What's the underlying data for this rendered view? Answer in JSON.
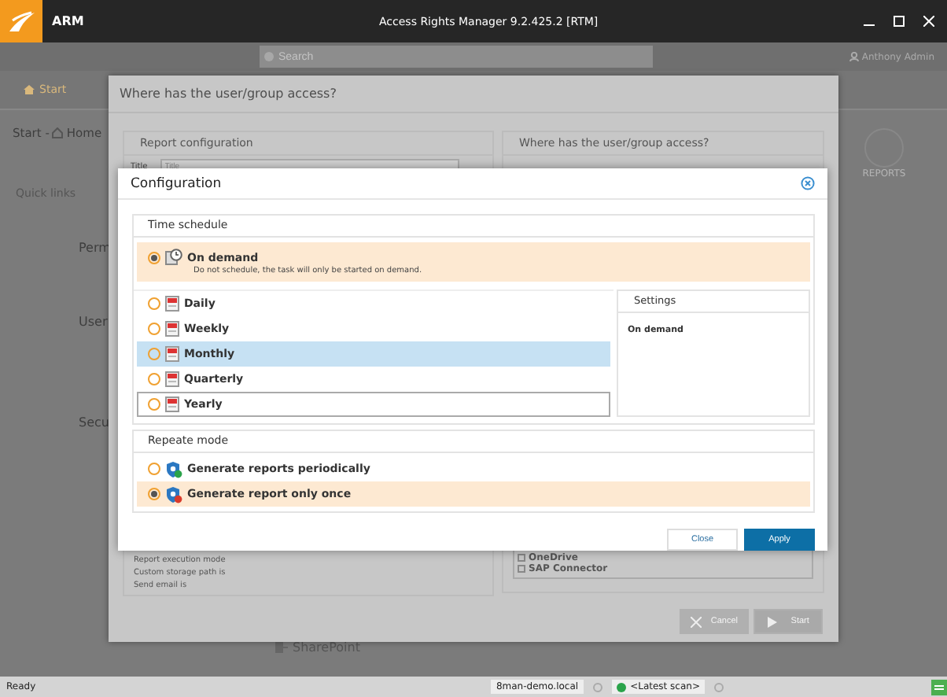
{
  "window": {
    "title": "ARM",
    "app_title": "Access Rights Manager  9.2.425.2 [RTM]"
  },
  "toolbar": {
    "search": {
      "placeholder": "Search"
    },
    "user": "Anthony Admin"
  },
  "nav": [
    "Start"
  ],
  "breadcrumb": {
    "root": "Start -",
    "page": "Home"
  },
  "background": {
    "quick_links": "Quick links",
    "sections": [
      "Perm",
      "User",
      "Secu"
    ],
    "reports": "REPORTS",
    "sharepoint": "SharePoint"
  },
  "report_dialog": {
    "title": "Where has the user/group access?",
    "left_panel": {
      "title": "Report configuration",
      "field_label": "Title",
      "field_placeholder": "Title",
      "info": [
        "Report execution mode",
        "Custom storage path is",
        "Send email is"
      ]
    },
    "right_panel": {
      "title": "Where has the user/group access?",
      "tree": [
        "OneDrive",
        "SAP Connector"
      ]
    },
    "buttons": [
      "Cancel",
      "Start"
    ]
  },
  "config_dialog": {
    "title": "Configuration",
    "time_schedule": {
      "title": "Time schedule",
      "options": [
        {
          "kind": "manual",
          "label": "On demand",
          "description": "Do not schedule, the task will only be started on demand.",
          "selected": true,
          "highlighted": false,
          "focused": false
        },
        {
          "kind": "calendar",
          "label": "Daily",
          "selected": false,
          "highlighted": false,
          "focused": false
        },
        {
          "kind": "calendar",
          "label": "Weekly",
          "selected": false,
          "highlighted": false,
          "focused": false
        },
        {
          "kind": "calendar",
          "label": "Monthly",
          "selected": false,
          "highlighted": true,
          "focused": false
        },
        {
          "kind": "calendar",
          "label": "Quarterly",
          "selected": false,
          "highlighted": false,
          "focused": false
        },
        {
          "kind": "calendar",
          "label": "Yearly",
          "selected": false,
          "highlighted": false,
          "focused": true
        }
      ]
    },
    "settings": {
      "title": "Settings",
      "value": "On demand"
    },
    "repeat_mode": {
      "title": "Repeate mode",
      "options": [
        {
          "kind": "periodic",
          "label": "Generate reports periodically",
          "selected": false
        },
        {
          "kind": "once",
          "label": "Generate report only once",
          "selected": true
        }
      ]
    },
    "buttons": [
      {
        "kind": "secondary",
        "label": "Close"
      },
      {
        "kind": "primary",
        "label": "Apply"
      }
    ]
  },
  "status_bar": {
    "text": "Ready",
    "domain": "8man-demo.local",
    "scan": "<Latest scan>"
  }
}
